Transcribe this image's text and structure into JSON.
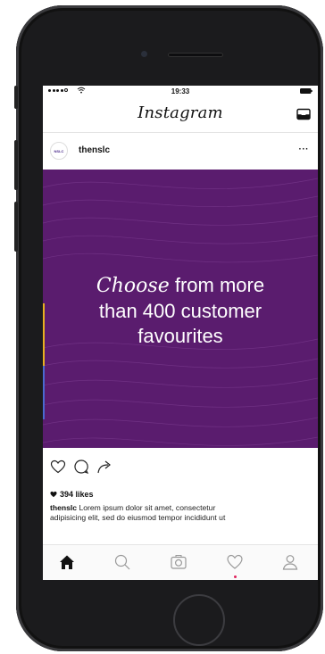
{
  "status_bar": {
    "time": "19:33"
  },
  "app": {
    "title": "Instagram",
    "inbox_icon": "inbox-icon"
  },
  "post": {
    "avatar_text": "NSLC",
    "username": "thenslc",
    "more_label": "···",
    "image_text": {
      "italic": "Choose",
      "line1_rest": " from more",
      "line2": "than 400 customer",
      "line3": "favourites"
    },
    "image_color": "#5a1c6e",
    "likes": "394 likes",
    "caption_user": "thenslc",
    "caption_line1": " Lorem ipsum dolor sit amet, consectetur",
    "caption_line2": "adipisicing elit, sed do eiusmod tempor incididunt ut"
  },
  "actions": [
    "heart-icon",
    "comment-icon",
    "share-icon"
  ],
  "bottom_nav": [
    "home-icon",
    "search-icon",
    "camera-icon",
    "activity-heart-icon",
    "profile-icon"
  ],
  "colors": {
    "accent_purple": "#5a1c6e",
    "notification_dot": "#e0245e"
  }
}
